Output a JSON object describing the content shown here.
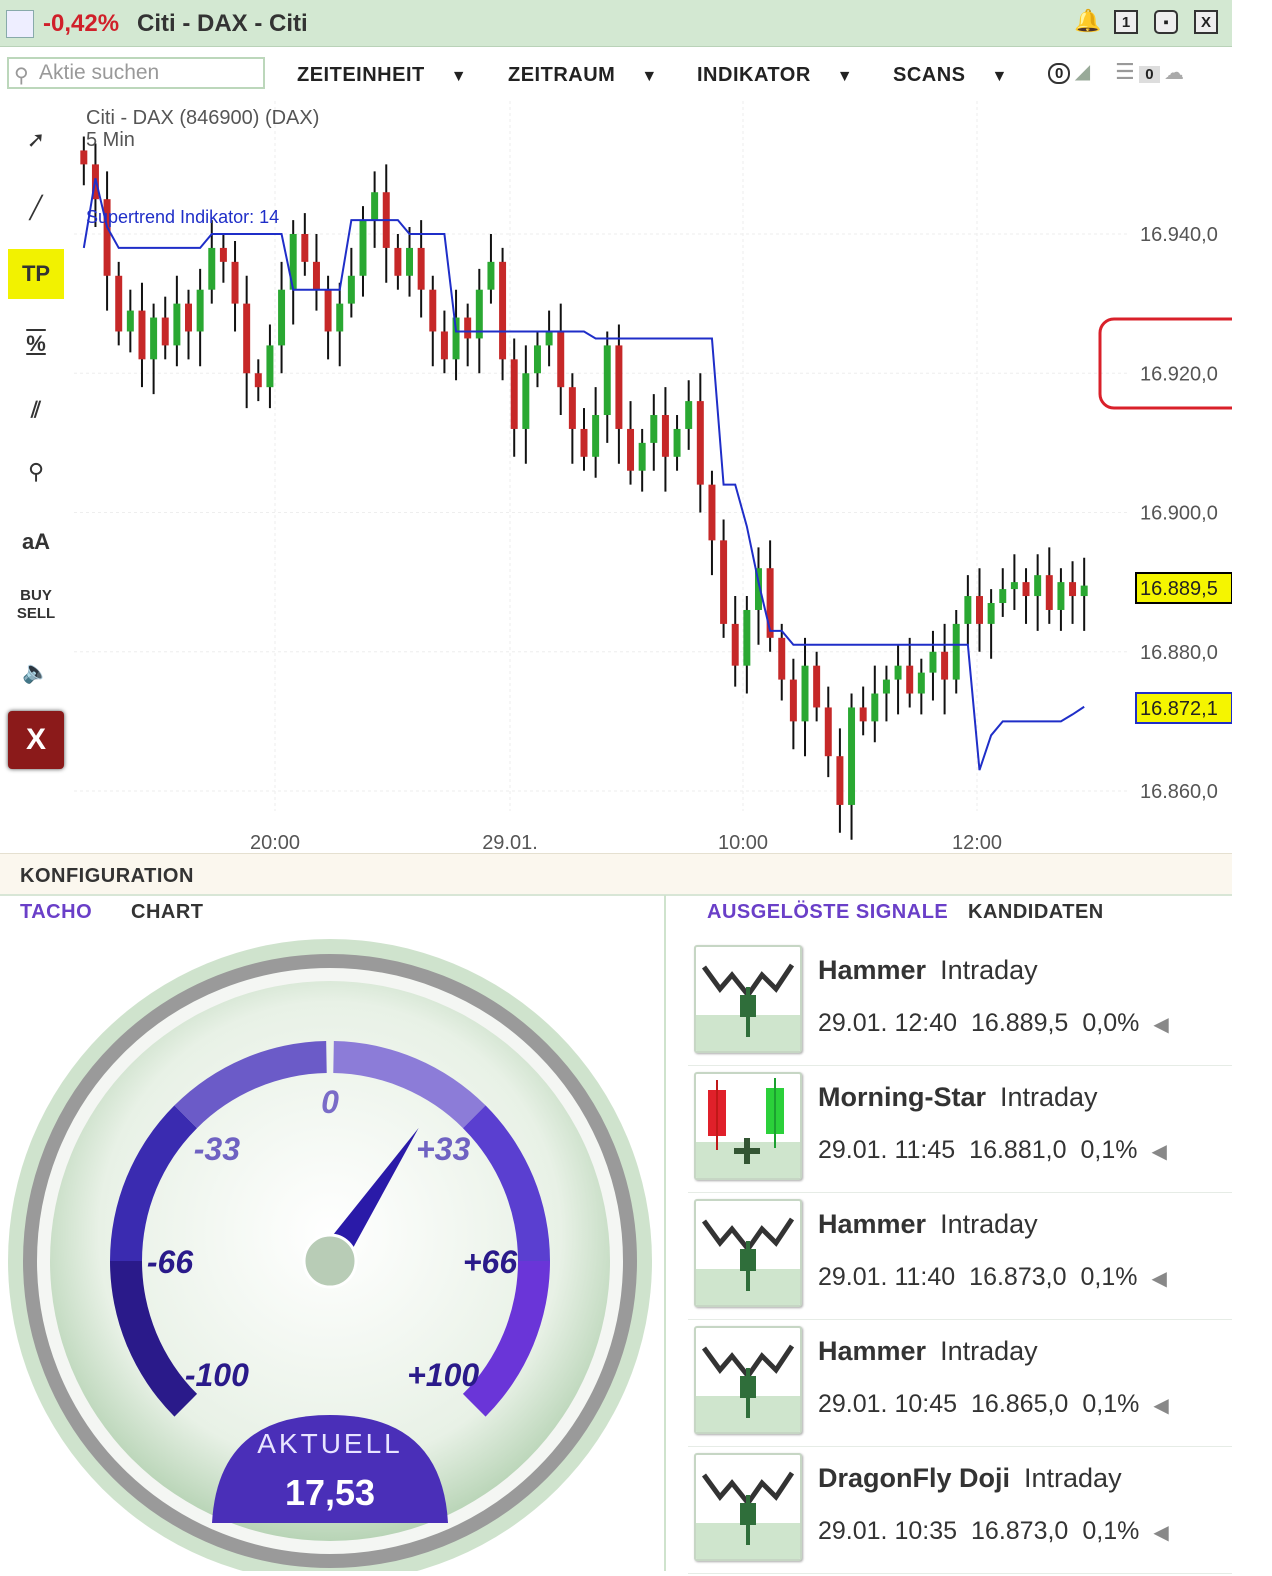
{
  "titlebar": {
    "change": "-0,42%",
    "title": "Citi - DAX - Citi",
    "icons": [
      "bell-icon",
      "window-1-icon",
      "restore-icon",
      "close-icon"
    ],
    "window_label": "1",
    "close_label": "X"
  },
  "toolbar": {
    "search_placeholder": "Aktie suchen",
    "menus": [
      "ZEITEINHEIT",
      "ZEITRAUM",
      "INDIKATOR",
      "SCANS"
    ],
    "alert_count": "0",
    "watch_count": "0"
  },
  "chart": {
    "title": "Citi - DAX (846900) (DAX)",
    "interval": "5 Min",
    "indicator_label": "Supertrend Indikator: 14",
    "current_price": "16.889,5",
    "supertrend_value": "16.872,1",
    "price_color": "#f5f500",
    "up_color": "#2aa832",
    "down_color": "#c62828",
    "supertrend_color": "#1f2ec8",
    "highlight_color": "#d9202a"
  },
  "chart_data": {
    "type": "candlestick",
    "title": "Citi - DAX (846900) (DAX)",
    "interval": "5 Min",
    "y_ticks": [
      "16.940,0",
      "16.920,0",
      "16.900,0",
      "16.880,0",
      "16.860,0"
    ],
    "x_ticks": [
      "20:00",
      "29.01.",
      "10:00",
      "12:00"
    ],
    "ylim": [
      16855,
      16955
    ],
    "closes": [
      16950,
      16945,
      16934,
      16926,
      16929,
      16922,
      16928,
      16924,
      16930,
      16926,
      16932,
      16938,
      16936,
      16930,
      16920,
      16918,
      16924,
      16932,
      16940,
      16936,
      16932,
      16926,
      16930,
      16934,
      16942,
      16946,
      16938,
      16934,
      16938,
      16932,
      16926,
      16922,
      16928,
      16925,
      16932,
      16936,
      16922,
      16912,
      16920,
      16924,
      16926,
      16918,
      16912,
      16908,
      16914,
      16924,
      16912,
      16906,
      16910,
      16914,
      16908,
      16912,
      16916,
      16904,
      16896,
      16884,
      16878,
      16886,
      16892,
      16882,
      16876,
      16870,
      16878,
      16872,
      16865,
      16858,
      16872,
      16870,
      16874,
      16876,
      16878,
      16874,
      16877,
      16880,
      16876,
      16884,
      16888,
      16884,
      16887,
      16889,
      16890,
      16888,
      16891,
      16886,
      16890,
      16888,
      16889.5
    ],
    "supertrend": [
      16938,
      16948,
      16941,
      16938,
      16938,
      16938,
      16938,
      16938,
      16938,
      16938,
      16938,
      16940,
      16940,
      16940,
      16940,
      16940,
      16940,
      16940,
      16932,
      16932,
      16932,
      16932,
      16932,
      16942,
      16942,
      16942,
      16942,
      16942,
      16940,
      16940,
      16940,
      16940,
      16926,
      16926,
      16926,
      16926,
      16926,
      16926,
      16926,
      16926,
      16926,
      16926,
      16926,
      16926,
      16925,
      16925,
      16925,
      16925,
      16925,
      16925,
      16925,
      16925,
      16925,
      16925,
      16925,
      16904,
      16904,
      16898,
      16890,
      16883,
      16883,
      16881,
      16881,
      16881,
      16881,
      16881,
      16881,
      16881,
      16881,
      16881,
      16881,
      16881,
      16881,
      16881,
      16881,
      16881,
      16881,
      16863,
      16868,
      16870,
      16870,
      16870,
      16870,
      16870,
      16870,
      16871,
      16872.1
    ]
  },
  "left_tools": [
    "cursor-add",
    "line",
    "TP",
    "%",
    "parallel-lines",
    "zoom",
    "aA",
    "BUY SELL",
    "sound",
    "X"
  ],
  "bottom": {
    "konfig_label": "KONFIGURATION",
    "tabs_left": [
      "TACHO",
      "CHART"
    ],
    "tabs_right": [
      "AUSGELÖSTE SIGNALE",
      "KANDIDATEN"
    ],
    "active_color": "#6a3fc8"
  },
  "gauge": {
    "labels": [
      "-100",
      "-66",
      "-33",
      "0",
      "+33",
      "+66",
      "+100"
    ],
    "current_label": "AKTUELL",
    "current_value": "17,53",
    "value": 17.53
  },
  "signals": [
    {
      "pattern": "Hammer",
      "type": "Intraday",
      "datetime": "29.01. 12:40",
      "price": "16.889,5",
      "change": "0,0%",
      "icon": "hammer-icon"
    },
    {
      "pattern": "Morning-Star",
      "type": "Intraday",
      "datetime": "29.01. 11:45",
      "price": "16.881,0",
      "change": "0,1%",
      "icon": "morning-star-icon"
    },
    {
      "pattern": "Hammer",
      "type": "Intraday",
      "datetime": "29.01. 11:40",
      "price": "16.873,0",
      "change": "0,1%",
      "icon": "hammer-icon"
    },
    {
      "pattern": "Hammer",
      "type": "Intraday",
      "datetime": "29.01. 10:45",
      "price": "16.865,0",
      "change": "0,1%",
      "icon": "hammer-icon"
    },
    {
      "pattern": "DragonFly Doji",
      "type": "Intraday",
      "datetime": "29.01. 10:35",
      "price": "16.873,0",
      "change": "0,1%",
      "icon": "dragonfly-doji-icon"
    }
  ]
}
